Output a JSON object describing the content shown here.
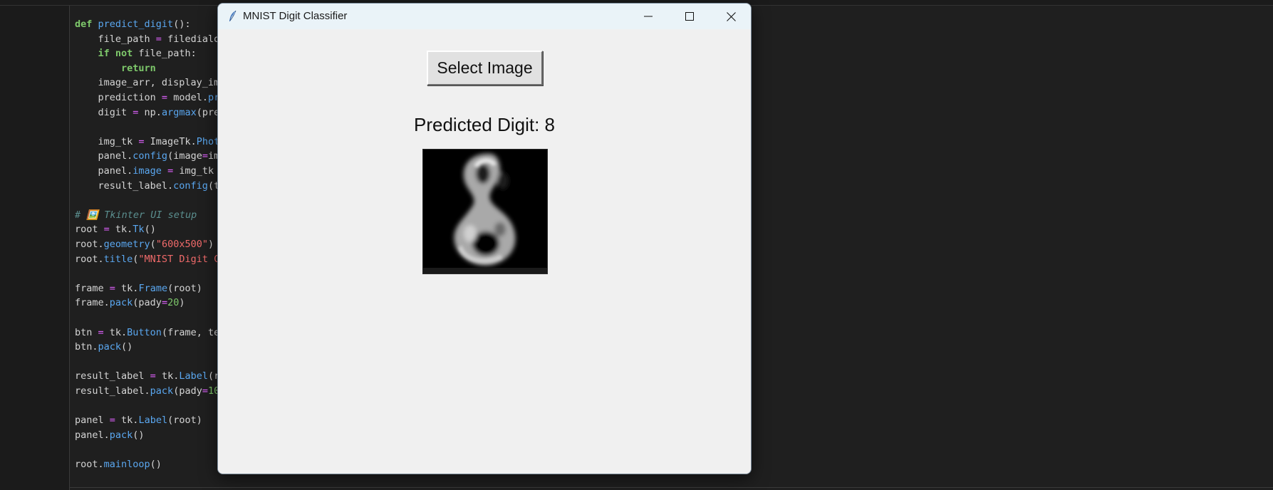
{
  "editor": {
    "lines": [
      [
        [
          "def ",
          "t-kw"
        ],
        [
          "predict_digit",
          "t-fn"
        ],
        [
          "():",
          "t-tx"
        ]
      ],
      [
        [
          "    file_path ",
          "t-tx"
        ],
        [
          "=",
          "t-op"
        ],
        [
          " filedialo",
          "t-tx"
        ]
      ],
      [
        [
          "    ",
          "t-tx"
        ],
        [
          "if not",
          "t-kw"
        ],
        [
          " file_path:",
          "t-tx"
        ]
      ],
      [
        [
          "        ",
          "t-tx"
        ],
        [
          "return",
          "t-kw"
        ]
      ],
      [
        [
          "    image_arr, display_im",
          "t-tx"
        ]
      ],
      [
        [
          "    prediction ",
          "t-tx"
        ],
        [
          "=",
          "t-op"
        ],
        [
          " model.",
          "t-tx"
        ],
        [
          "pr",
          "t-fn"
        ]
      ],
      [
        [
          "    digit ",
          "t-tx"
        ],
        [
          "=",
          "t-op"
        ],
        [
          " np.",
          "t-tx"
        ],
        [
          "argmax",
          "t-fn"
        ],
        [
          "(pre",
          "t-tx"
        ]
      ],
      [],
      [
        [
          "    img_tk ",
          "t-tx"
        ],
        [
          "=",
          "t-op"
        ],
        [
          " ImageTk.",
          "t-tx"
        ],
        [
          "Phot",
          "t-fn"
        ]
      ],
      [
        [
          "    panel.",
          "t-tx"
        ],
        [
          "config",
          "t-fn"
        ],
        [
          "(image",
          "t-tx"
        ],
        [
          "=",
          "t-op"
        ],
        [
          "im",
          "t-tx"
        ]
      ],
      [
        [
          "    panel.",
          "t-tx"
        ],
        [
          "image",
          "t-fn"
        ],
        [
          " ",
          "t-tx"
        ],
        [
          "=",
          "t-op"
        ],
        [
          " img_tk",
          "t-tx"
        ]
      ],
      [
        [
          "    result_label.",
          "t-tx"
        ],
        [
          "config",
          "t-fn"
        ],
        [
          "(t",
          "t-tx"
        ]
      ],
      [],
      [
        [
          "# 🖼️ Tkinter UI setup",
          "t-cm"
        ]
      ],
      [
        [
          "root ",
          "t-tx"
        ],
        [
          "=",
          "t-op"
        ],
        [
          " tk.",
          "t-tx"
        ],
        [
          "Tk",
          "t-fn"
        ],
        [
          "()",
          "t-tx"
        ]
      ],
      [
        [
          "root.",
          "t-tx"
        ],
        [
          "geometry",
          "t-fn"
        ],
        [
          "(",
          "t-tx"
        ],
        [
          "\"600x500\"",
          "t-str"
        ],
        [
          ")",
          "t-tx"
        ]
      ],
      [
        [
          "root.",
          "t-tx"
        ],
        [
          "title",
          "t-fn"
        ],
        [
          "(",
          "t-tx"
        ],
        [
          "\"MNIST Digit C",
          "t-str"
        ]
      ],
      [],
      [
        [
          "frame ",
          "t-tx"
        ],
        [
          "=",
          "t-op"
        ],
        [
          " tk.",
          "t-tx"
        ],
        [
          "Frame",
          "t-fn"
        ],
        [
          "(root)",
          "t-tx"
        ]
      ],
      [
        [
          "frame.",
          "t-tx"
        ],
        [
          "pack",
          "t-fn"
        ],
        [
          "(pady",
          "t-tx"
        ],
        [
          "=",
          "t-op"
        ],
        [
          "20",
          "t-num"
        ],
        [
          ")",
          "t-tx"
        ]
      ],
      [],
      [
        [
          "btn ",
          "t-tx"
        ],
        [
          "=",
          "t-op"
        ],
        [
          " tk.",
          "t-tx"
        ],
        [
          "Button",
          "t-fn"
        ],
        [
          "(frame, te",
          "t-tx"
        ]
      ],
      [
        [
          "btn.",
          "t-tx"
        ],
        [
          "pack",
          "t-fn"
        ],
        [
          "()",
          "t-tx"
        ]
      ],
      [],
      [
        [
          "result_label ",
          "t-tx"
        ],
        [
          "=",
          "t-op"
        ],
        [
          " tk.",
          "t-tx"
        ],
        [
          "Label",
          "t-fn"
        ],
        [
          "(r",
          "t-tx"
        ]
      ],
      [
        [
          "result_label.",
          "t-tx"
        ],
        [
          "pack",
          "t-fn"
        ],
        [
          "(pady",
          "t-tx"
        ],
        [
          "=",
          "t-op"
        ],
        [
          "10",
          "t-num"
        ]
      ],
      [],
      [
        [
          "panel ",
          "t-tx"
        ],
        [
          "=",
          "t-op"
        ],
        [
          " tk.",
          "t-tx"
        ],
        [
          "Label",
          "t-fn"
        ],
        [
          "(root)",
          "t-tx"
        ]
      ],
      [
        [
          "panel.",
          "t-tx"
        ],
        [
          "pack",
          "t-fn"
        ],
        [
          "()",
          "t-tx"
        ]
      ],
      [],
      [
        [
          "root.",
          "t-tx"
        ],
        [
          "mainloop",
          "t-fn"
        ],
        [
          "()",
          "t-tx"
        ]
      ]
    ]
  },
  "window": {
    "title": "MNIST Digit Classifier",
    "icon": "tk-feather-icon",
    "controls": [
      "minimize-icon",
      "maximize-icon",
      "close-icon"
    ]
  },
  "app": {
    "select_button_label": "Select Image",
    "result_text": "Predicted Digit: 8",
    "image_icon": "digit-8-image"
  },
  "colors": {
    "keyword": "#7ec96b",
    "function": "#5aa7f0",
    "operator": "#e061ff",
    "string": "#f06a6a",
    "comment": "#5b8f8f",
    "titlebar": "#eaf3f8",
    "window_bg": "#f0f0f0"
  }
}
